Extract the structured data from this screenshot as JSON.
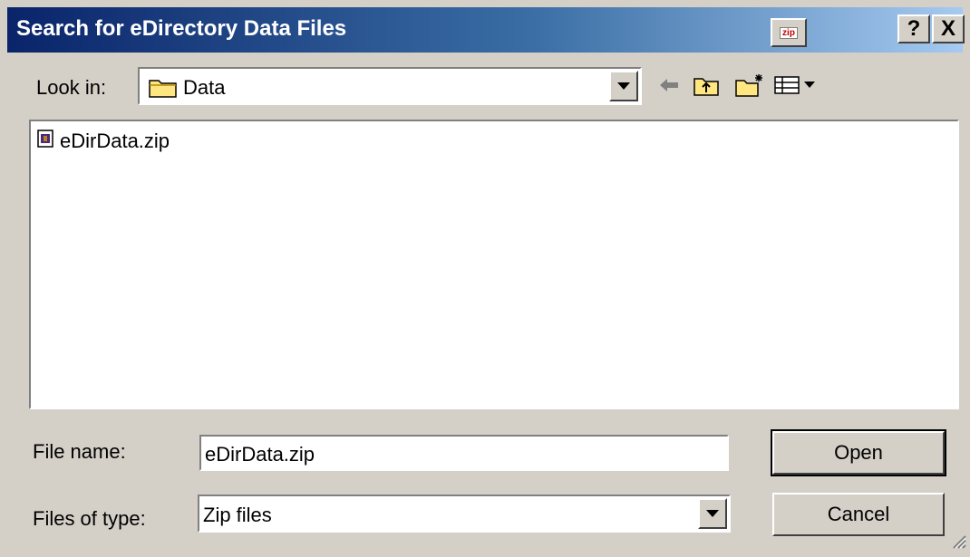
{
  "window": {
    "title": "Search for eDirectory Data Files",
    "zip_badge": "zip",
    "help_label": "?",
    "close_label": "X"
  },
  "lookin": {
    "label": "Look in:",
    "value": "Data"
  },
  "toolbar": {
    "icons": [
      "back-arrow-icon",
      "up-folder-icon",
      "new-folder-icon",
      "view-menu-icon"
    ]
  },
  "files": [
    {
      "name": "eDirData.zip",
      "icon": "zip-file-icon"
    }
  ],
  "filename": {
    "label": "File name:",
    "value": "eDirData.zip"
  },
  "filetype": {
    "label": "Files of type:",
    "value": "Zip files"
  },
  "buttons": {
    "open": "Open",
    "cancel": "Cancel"
  },
  "colors": {
    "title_start": "#0a246a",
    "title_end": "#a6caf0",
    "face": "#d4d0c8"
  }
}
